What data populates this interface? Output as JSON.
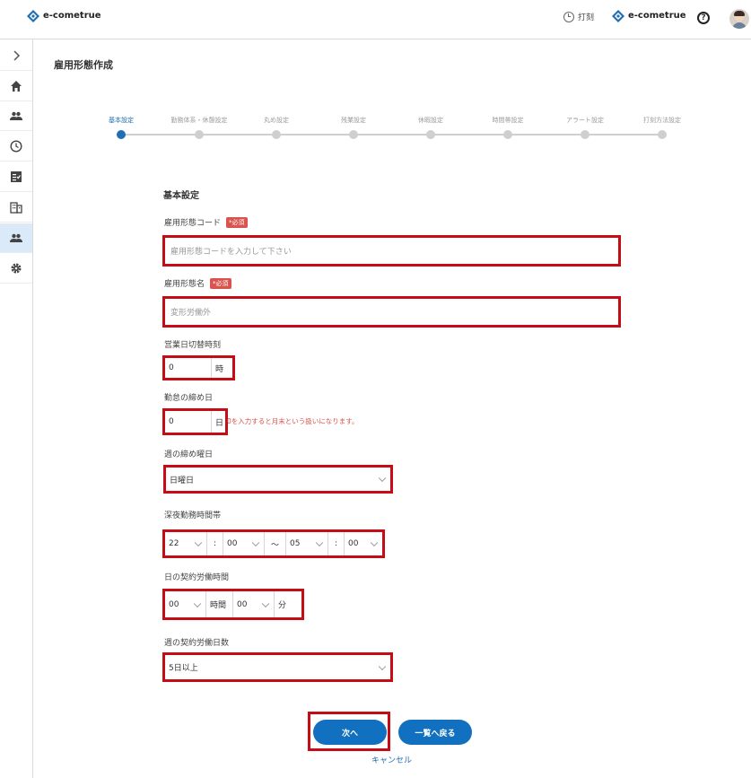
{
  "header": {
    "logo_text": "e-cometrue",
    "punch_label": "打刻",
    "company_logo_text": "e-cometrue",
    "help_label": "?"
  },
  "sidebar": {
    "items": [
      {
        "name": "expand",
        "icon": "chevron-right-icon"
      },
      {
        "name": "home",
        "icon": "home-icon"
      },
      {
        "name": "users",
        "icon": "users-icon"
      },
      {
        "name": "attendance",
        "icon": "clock-icon"
      },
      {
        "name": "approval",
        "icon": "checklist-icon"
      },
      {
        "name": "company",
        "icon": "building-icon"
      },
      {
        "name": "employment",
        "icon": "users-icon",
        "active": true
      },
      {
        "name": "settings",
        "icon": "gear-icon"
      }
    ]
  },
  "page_title": "雇用形態作成",
  "steps": [
    {
      "label": "基本設定",
      "active": true
    },
    {
      "label": "勤務体系・休憩設定"
    },
    {
      "label": "丸め設定"
    },
    {
      "label": "残業設定"
    },
    {
      "label": "休暇設定"
    },
    {
      "label": "時間帯設定"
    },
    {
      "label": "アラート設定"
    },
    {
      "label": "打刻方法設定"
    }
  ],
  "form": {
    "section_title": "基本設定",
    "required_badge": "*必須",
    "code": {
      "label": "雇用形態コード",
      "placeholder": "雇用形態コードを入力して下さい"
    },
    "name": {
      "label": "雇用形態名",
      "placeholder": "変形労働外"
    },
    "day_switch": {
      "label": "営業日切替時刻",
      "value": "0",
      "unit": "時"
    },
    "closing_day": {
      "label": "勤怠の締め日",
      "value": "0",
      "unit": "日",
      "note": "0を入力すると月末という扱いになります。"
    },
    "week_closing": {
      "label": "週の締め曜日",
      "value": "日曜日"
    },
    "night_hours": {
      "label": "深夜勤務時間帯",
      "start_h": "22",
      "start_m": "00",
      "tilde": "〜",
      "end_h": "05",
      "end_m": "00",
      "colon": ":"
    },
    "daily_contract": {
      "label": "日の契約労働時間",
      "hours": "00",
      "hours_unit": "時間",
      "minutes": "00",
      "minutes_unit": "分"
    },
    "weekly_days": {
      "label": "週の契約労働日数",
      "value": "5日以上"
    }
  },
  "buttons": {
    "next": "次へ",
    "back_to_list": "一覧へ戻る",
    "cancel": "キャンセル"
  },
  "colors": {
    "primary": "#1170bf",
    "highlight": "#c50d15",
    "required": "#d9534f"
  }
}
